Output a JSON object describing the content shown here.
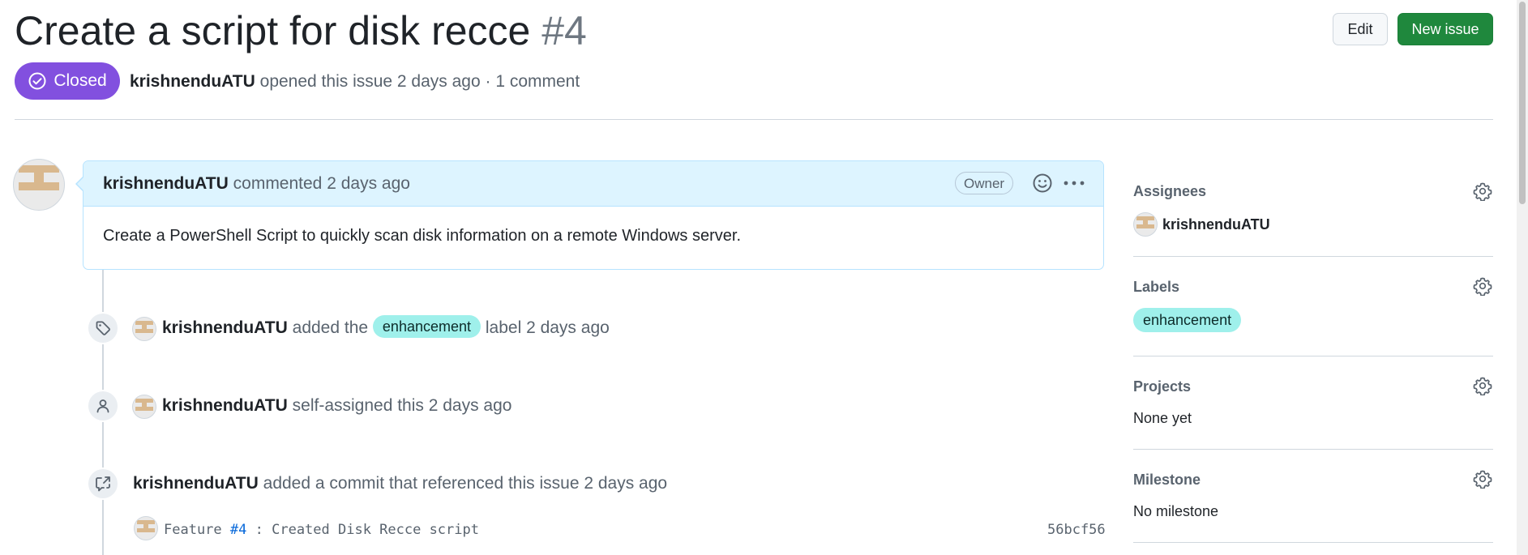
{
  "issue": {
    "title": "Create a script for disk recce",
    "number": "#4",
    "state": "Closed",
    "author": "krishnenduATU",
    "opened_text": "opened this issue 2 days ago · 1 comment"
  },
  "header": {
    "edit_label": "Edit",
    "new_issue_label": "New issue"
  },
  "comment": {
    "author": "krishnenduATU",
    "meta": "commented 2 days ago",
    "badge": "Owner",
    "body": "Create a PowerShell Script to quickly scan disk information on a remote Windows server."
  },
  "timeline": {
    "label_event": {
      "author": "krishnenduATU",
      "prefix": "added the",
      "label": "enhancement",
      "suffix": "label 2 days ago"
    },
    "assign_event": {
      "author": "krishnenduATU",
      "text": "self-assigned this 2 days ago"
    },
    "commit_event": {
      "author": "krishnenduATU",
      "text": "added a commit that referenced this issue 2 days ago",
      "message_prefix": "Feature",
      "message_ref": "#4",
      "message_suffix": ": Created Disk Recce script",
      "sha": "56bcf56"
    }
  },
  "sidebar": {
    "assignees": {
      "title": "Assignees",
      "value": "krishnenduATU"
    },
    "labels": {
      "title": "Labels",
      "value": "enhancement"
    },
    "projects": {
      "title": "Projects",
      "value": "None yet"
    },
    "milestone": {
      "title": "Milestone",
      "value": "No milestone"
    }
  },
  "colors": {
    "closed_purple": "#8250df",
    "primary_green": "#1f883d",
    "label_cyan": "#9ff0eb",
    "comment_header_blue": "#ddf4ff"
  },
  "icons": [
    "check-circle-icon",
    "smiley-icon",
    "kebab-icon",
    "tag-icon",
    "person-icon",
    "cross-reference-icon",
    "gear-icon"
  ]
}
